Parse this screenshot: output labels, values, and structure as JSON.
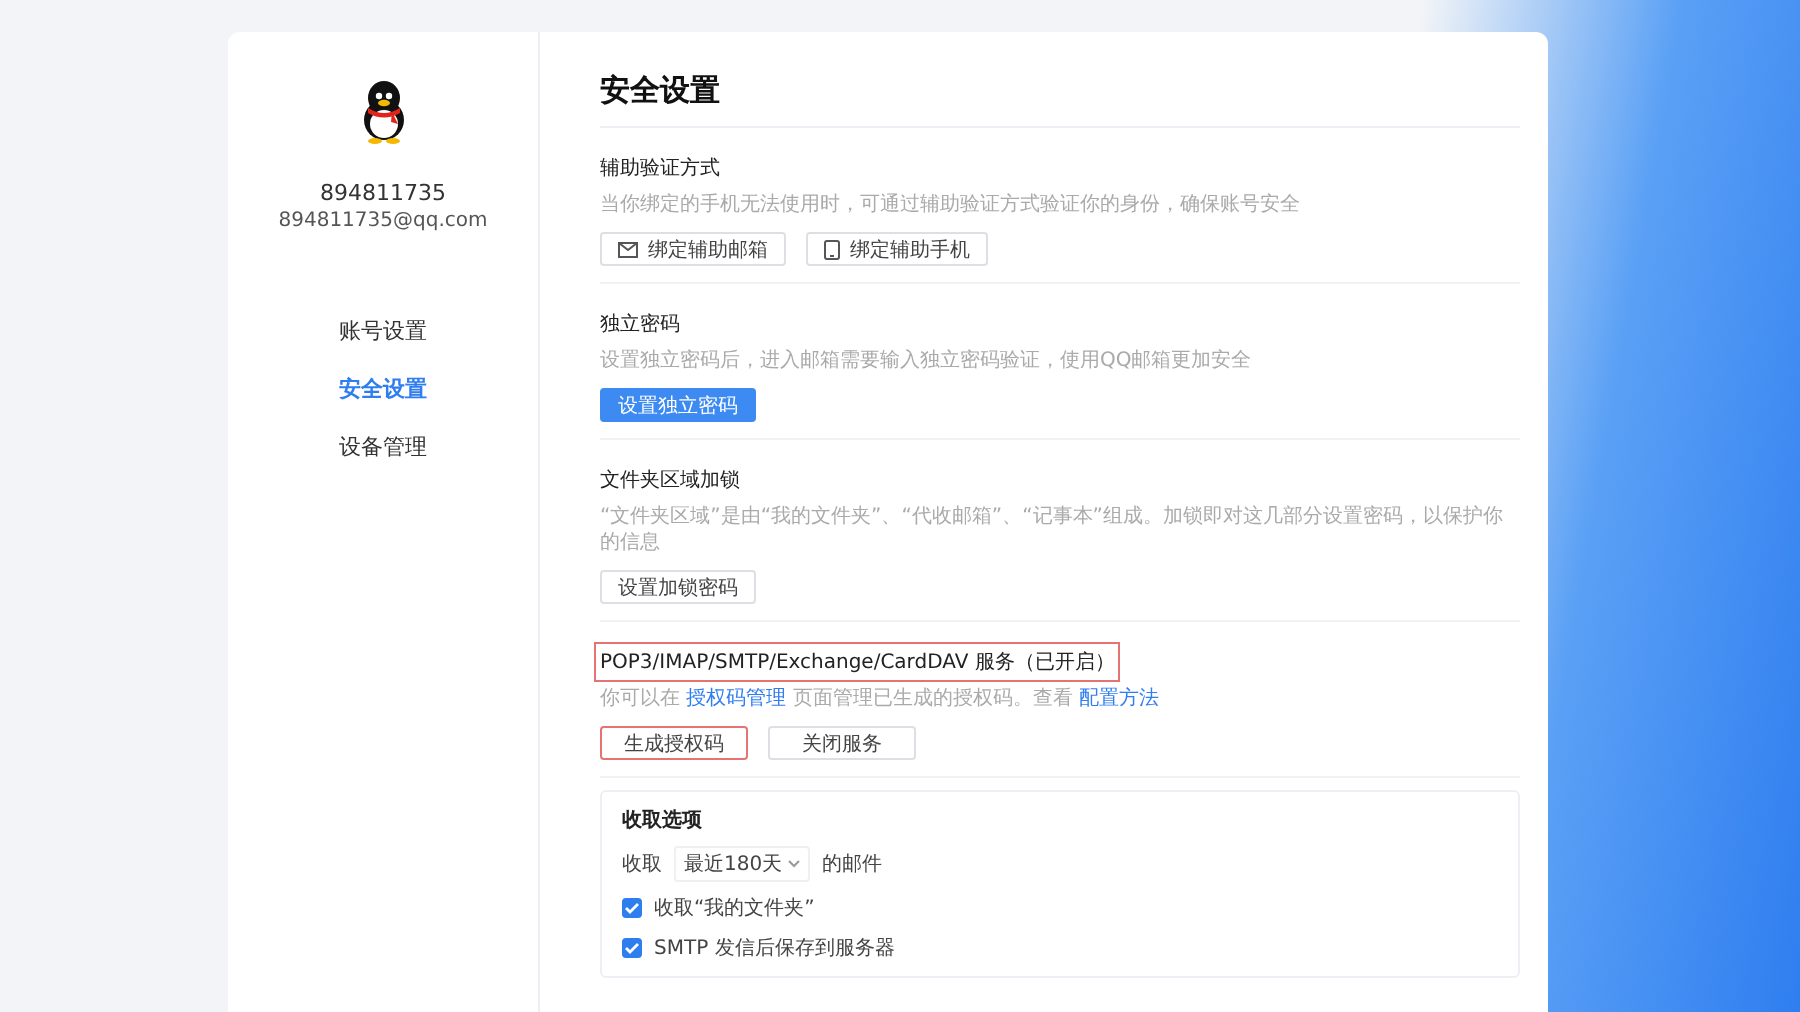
{
  "sidebar": {
    "account_id": "894811735",
    "email": "894811735@qq.com",
    "nav": [
      {
        "label": "账号设置",
        "selected": false
      },
      {
        "label": "安全设置",
        "selected": true
      },
      {
        "label": "设备管理",
        "selected": false
      }
    ]
  },
  "main": {
    "title": "安全设置",
    "sections": [
      {
        "title": "辅助验证方式",
        "title_highlighted": false,
        "description": [
          {
            "kind": "text",
            "text": "当你绑定的手机无法使用时，可通过辅助验证方式验证你的身份，确保账号安全"
          }
        ],
        "buttons": [
          {
            "label": "绑定辅助邮箱",
            "kind": "mail",
            "highlighted": false
          },
          {
            "label": "绑定辅助手机",
            "kind": "phone",
            "highlighted": false
          }
        ]
      },
      {
        "title": "独立密码",
        "title_highlighted": false,
        "description": [
          {
            "kind": "text",
            "text": "设置独立密码后，进入邮箱需要输入独立密码验证，使用QQ邮箱更加安全"
          }
        ],
        "buttons": [
          {
            "label": "设置独立密码",
            "kind": "primary",
            "highlighted": false
          }
        ]
      },
      {
        "title": "文件夹区域加锁",
        "title_highlighted": false,
        "description": [
          {
            "kind": "text",
            "text": "“文件夹区域”是由“我的文件夹”、“代收邮箱”、“记事本”组成。加锁即对这几部分设置密码，以保护你的信息"
          }
        ],
        "buttons": [
          {
            "label": "设置加锁密码",
            "kind": "default",
            "highlighted": false
          }
        ]
      },
      {
        "title": "POP3/IMAP/SMTP/Exchange/CardDAV 服务（已开启）",
        "title_highlighted": true,
        "description": [
          {
            "kind": "text",
            "text": "你可以在 "
          },
          {
            "kind": "link",
            "text": "授权码管理"
          },
          {
            "kind": "text",
            "text": " 页面管理已生成的授权码。查看 "
          },
          {
            "kind": "link",
            "text": "配置方法"
          }
        ],
        "buttons": [
          {
            "label": "生成授权码",
            "kind": "default",
            "highlighted": true
          },
          {
            "label": "关闭服务",
            "kind": "default",
            "highlighted": false
          }
        ]
      }
    ],
    "fetch_options": {
      "title": "收取选项",
      "prefix": "收取",
      "range": "最近180天",
      "suffix": "的邮件",
      "options": [
        {
          "label": "收取“我的文件夹”",
          "checked": true
        },
        {
          "label": "SMTP 发信后保存到服务器",
          "checked": true
        }
      ]
    }
  }
}
